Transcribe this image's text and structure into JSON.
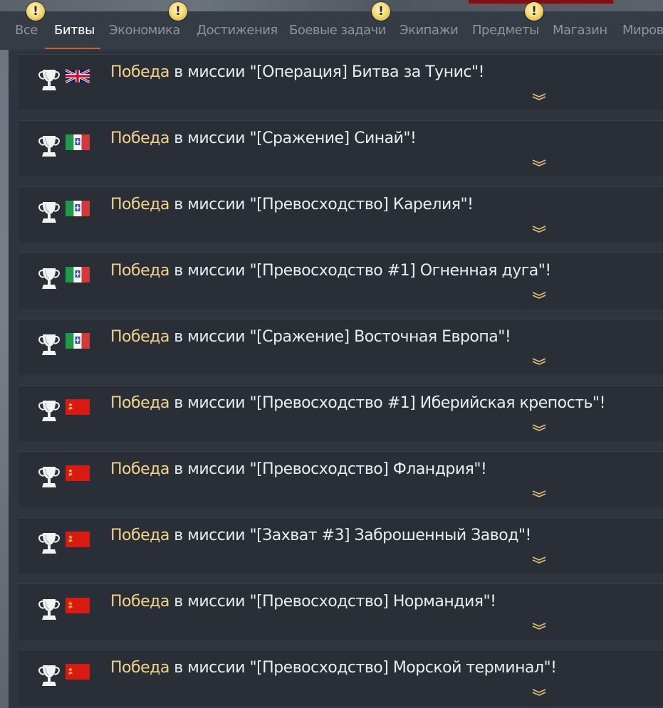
{
  "tabs": [
    {
      "label": "Все",
      "active": false,
      "badge": false
    },
    {
      "label": "Битвы",
      "active": true,
      "badge": false
    },
    {
      "label": "Экономика",
      "active": false,
      "badge": false
    },
    {
      "label": "Достижения",
      "active": false,
      "badge": false
    },
    {
      "label": "Боевые задачи",
      "active": false,
      "badge": false
    },
    {
      "label": "Экипажи",
      "active": false,
      "badge": false
    },
    {
      "label": "Предметы",
      "active": false,
      "badge": false
    },
    {
      "label": "Магазин",
      "active": false,
      "badge": false
    },
    {
      "label": "Миров",
      "active": false,
      "badge": false
    }
  ],
  "badge_symbol": "!",
  "win_word": "Победа",
  "mission_prefix": " в миссии ",
  "rows": [
    {
      "flag": "uk",
      "mission": "\"[Операция] Битва за Тунис\"!"
    },
    {
      "flag": "italy",
      "mission": "\"[Сражение] Синай\"!"
    },
    {
      "flag": "italy",
      "mission": "\"[Превосходство] Карелия\"!"
    },
    {
      "flag": "italy",
      "mission": "\"[Превосходство #1] Огненная дуга\"!"
    },
    {
      "flag": "italy",
      "mission": "\"[Сражение] Восточная Европа\"!"
    },
    {
      "flag": "ussr",
      "mission": "\"[Превосходство #1] Иберийская крепость\"!"
    },
    {
      "flag": "ussr",
      "mission": "\"[Превосходство] Фландрия\"!"
    },
    {
      "flag": "ussr",
      "mission": "\"[Захват #3] Заброшенный Завод\"!"
    },
    {
      "flag": "ussr",
      "mission": "\"[Превосходство] Нормандия\"!"
    },
    {
      "flag": "ussr",
      "mission": "\"[Превосходство] Морской терминал\"!"
    }
  ],
  "colors": {
    "win_text": "#f1d38c",
    "active_tab_underline": "#c9602a",
    "badge": "#f4dc7b"
  },
  "icons": {
    "row_icon": "trophy-icon",
    "expand_icon": "chevron-double-down-icon",
    "badge_icon": "exclamation-badge-icon"
  }
}
